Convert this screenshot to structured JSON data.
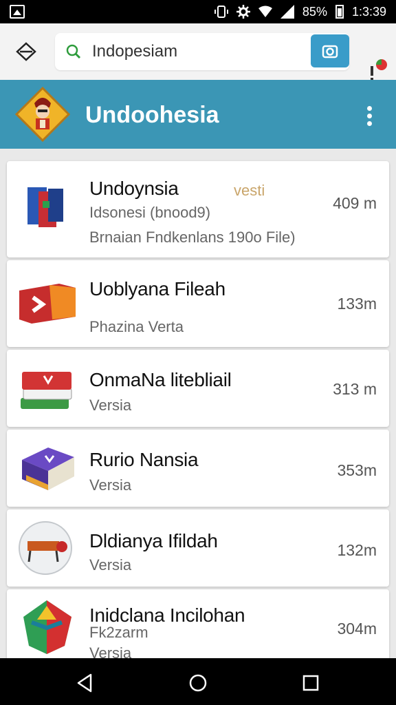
{
  "status_bar": {
    "battery": "85%",
    "time": "1:3:39"
  },
  "search": {
    "query": "Indopesiam"
  },
  "app_header": {
    "title": "Undoohesia"
  },
  "items": [
    {
      "title": "Undoynsia",
      "tag": "vesti",
      "line2": "Idsonesi (bnood9)",
      "line3": "Brnaian Fndkenlans 190o File)",
      "size": "409 m"
    },
    {
      "title": "Uoblyana Fileah",
      "line2": "Phazina Verta",
      "size": "133m"
    },
    {
      "title": "OnmaNa litebliail",
      "line2": "Versia",
      "size": "313 m"
    },
    {
      "title": "Rurio Nansia",
      "line2": "Versia",
      "size": "353m"
    },
    {
      "title": "Dldianya Ifildah",
      "line2": "Versia",
      "size": "132m"
    },
    {
      "title": "Inidclana Incilohan",
      "line2": "Fk2zarm",
      "line3": "Versia",
      "size": "304m"
    }
  ],
  "colors": {
    "header": "#3b96b5",
    "camera_button": "#3a9cc9"
  }
}
